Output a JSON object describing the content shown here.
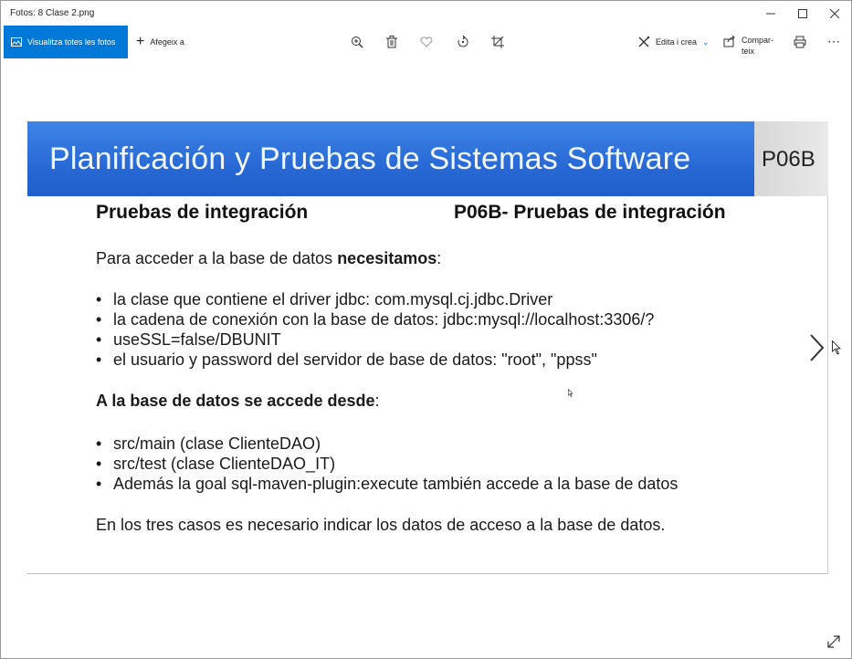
{
  "window": {
    "title": "Fotos: 8 Clase 2.png",
    "controls": [
      "minimize-icon",
      "maximize-icon",
      "close-icon"
    ]
  },
  "toolbar": {
    "view_all_label": "Visualitza totes les fotos",
    "add_to_label": "Afegeix a",
    "icons": [
      "zoom-in-icon",
      "delete-icon",
      "favorite-icon",
      "rotate-icon",
      "crop-icon"
    ],
    "edit_label": "Edita i crea",
    "share_label": "Compar-teix",
    "print_icon": "print-icon",
    "more_icon": "more-icon"
  },
  "slide": {
    "banner_title": "Planificación y Pruebas de Sistemas Software",
    "banner_code": "P06B",
    "section_left": "Pruebas de integración",
    "section_right": "P06B- Pruebas de integración",
    "intro_plain": "Para acceder a la base de datos ",
    "intro_bold": "necesitamos",
    "intro_end": ":",
    "needs": [
      "la clase que contiene el driver jdbc: com.mysql.cj.jdbc.Driver",
      "la cadena de conexión con la base de datos: jdbc:mysql://localhost:3306/?",
      "el usuario y password del servidor de base de datos: \"root\", \"ppss\""
    ],
    "needs_continuation": "useSSL=false/DBUNIT",
    "access_bold": "A la base de datos se accede desde",
    "access_end": ":",
    "access_items": [
      "src/main (clase ClienteDAO)",
      "src/test (clase ClienteDAO_IT)",
      "Además la goal sql-maven-plugin:execute también accede a la base de datos"
    ],
    "conclusion": "En los tres casos es necesario indicar los datos de acceso a la base de datos."
  },
  "colors": {
    "accent": "#0078d7",
    "banner": "#2a6fdb"
  }
}
